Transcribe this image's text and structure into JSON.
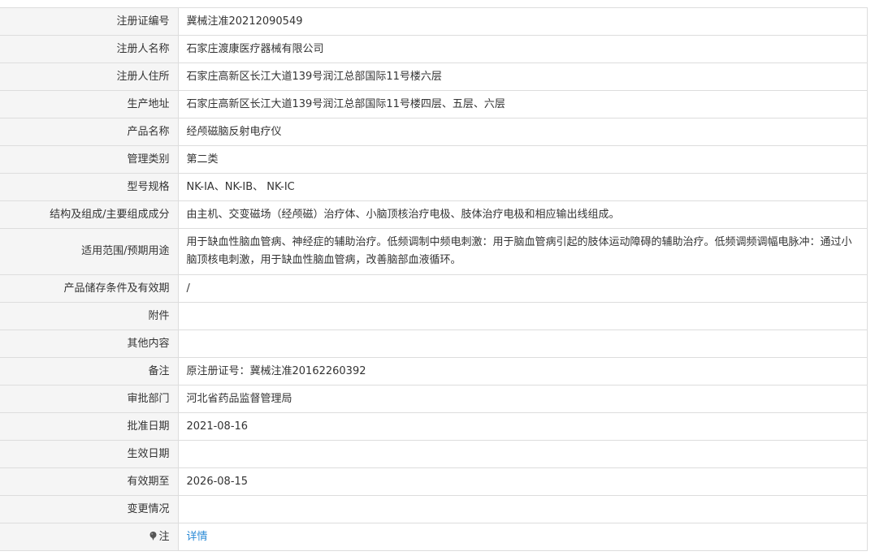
{
  "rows": [
    {
      "label": "注册证编号",
      "value": "冀械注准20212090549"
    },
    {
      "label": "注册人名称",
      "value": "石家庄渡康医疗器械有限公司"
    },
    {
      "label": "注册人住所",
      "value": "石家庄高新区长江大道139号润江总部国际11号楼六层"
    },
    {
      "label": "生产地址",
      "value": "石家庄高新区长江大道139号润江总部国际11号楼四层、五层、六层"
    },
    {
      "label": "产品名称",
      "value": "经颅磁脑反射电疗仪"
    },
    {
      "label": "管理类别",
      "value": "第二类"
    },
    {
      "label": "型号规格",
      "value": "NK-IA、NK-IB、 NK-IC"
    },
    {
      "label": "结构及组成/主要组成成分",
      "value": "由主机、交变磁场（经颅磁）治疗体、小脑顶核治疗电极、肢体治疗电极和相应输出线组成。"
    },
    {
      "label": "适用范围/预期用途",
      "value": "用于缺血性脑血管病、神经症的辅助治疗。低频调制中频电刺激：用于脑血管病引起的肢体运动障碍的辅助治疗。低频调频调幅电脉冲：通过小脑顶核电刺激，用于缺血性脑血管病，改善脑部血液循环。"
    },
    {
      "label": "产品储存条件及有效期",
      "value": "/"
    },
    {
      "label": "附件",
      "value": ""
    },
    {
      "label": "其他内容",
      "value": ""
    },
    {
      "label": "备注",
      "value": "原注册证号：冀械注准20162260392"
    },
    {
      "label": "审批部门",
      "value": "河北省药品监督管理局"
    },
    {
      "label": "批准日期",
      "value": "2021-08-16"
    },
    {
      "label": "生效日期",
      "value": ""
    },
    {
      "label": "有效期至",
      "value": "2026-08-15"
    },
    {
      "label": "变更情况",
      "value": ""
    }
  ],
  "note_row": {
    "icon": "pin-icon",
    "label": "注",
    "link_text": "详情"
  },
  "colors": {
    "label_bg": "#f5f5f5",
    "border": "#dddddd",
    "link": "#2b8bd6"
  }
}
